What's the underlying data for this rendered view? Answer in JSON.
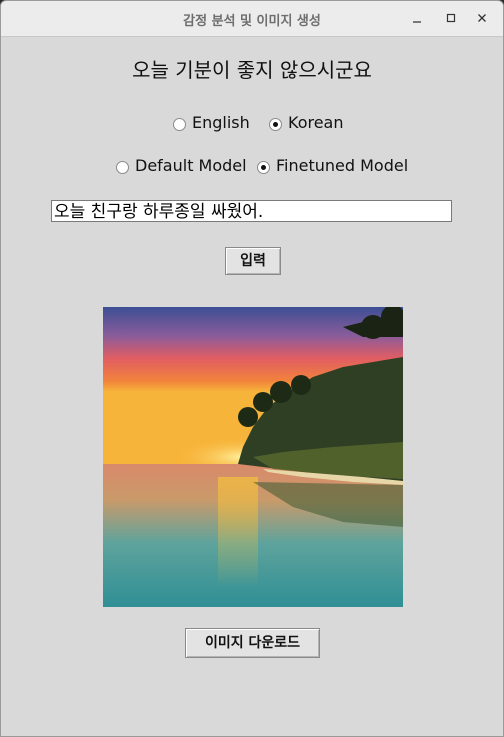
{
  "window": {
    "title": "감정 분석 및 이미지 생성",
    "controls": {
      "minimize_icon": "minimize-icon",
      "maximize_icon": "maximize-icon",
      "close_icon": "close-icon"
    }
  },
  "headline": "오늘 기분이 좋지 않으시군요",
  "language": {
    "options": [
      "English",
      "Korean"
    ],
    "selected": "Korean"
  },
  "model": {
    "options": [
      "Default Model",
      "Finetuned Model"
    ],
    "selected": "Finetuned Model"
  },
  "input": {
    "value": "오늘 친구랑 하루종일 싸웠어."
  },
  "buttons": {
    "submit_label": "입력",
    "download_label": "이미지 다운로드"
  },
  "image": {
    "description_icon": "generated-image",
    "colors": {
      "sky_top": "#4a5fa0",
      "sky_mid": "#e8605a",
      "horizon": "#f5b13a",
      "water": "#3f9b9b",
      "land": "#2e3f22"
    }
  }
}
